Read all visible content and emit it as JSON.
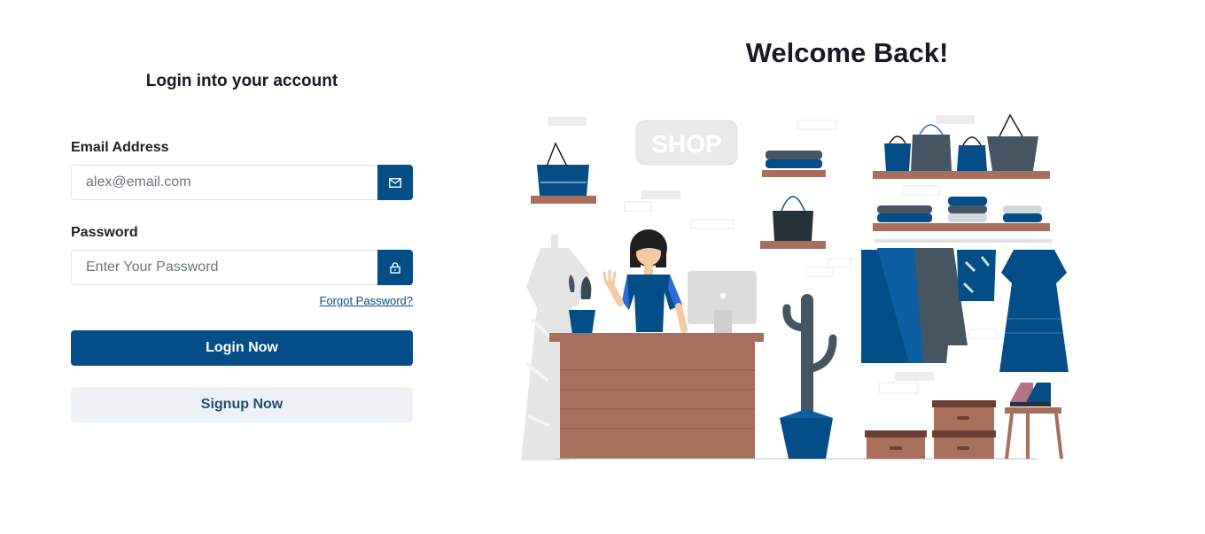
{
  "login": {
    "title": "Login into your account",
    "email_label": "Email Address",
    "email_placeholder": "alex@email.com",
    "email_icon": "mail-icon",
    "password_label": "Password",
    "password_placeholder": "Enter Your Password",
    "password_icon": "lock-icon",
    "forgot_link": "Forgot Password?",
    "login_button": "Login Now",
    "signup_button": "Signup Now"
  },
  "welcome": {
    "heading": "Welcome Back!",
    "illustration_text": "SHOP"
  },
  "colors": {
    "primary": "#044e87",
    "secondary_bg": "#edf1f5",
    "wood": "#a86f5d"
  }
}
